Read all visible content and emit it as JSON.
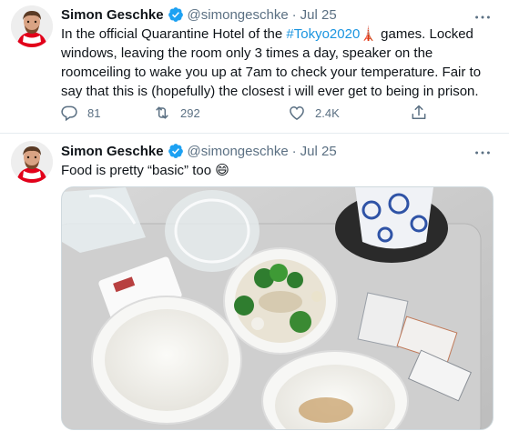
{
  "tweets": [
    {
      "author_name": "Simon Geschke",
      "handle": "@simongeschke",
      "separator": "·",
      "date": "Jul 25",
      "text_before": "In the official Quarantine Hotel of the ",
      "hashtag": "#Tokyo2020",
      "text_emoji": "🗼",
      "text_after": " games. Locked windows, leaving the room only 3 times a day, speaker on the roomceiling to wake you up at 7am to check your temperature. Fair to say that this is (hopefully) the closest i will ever get to being in prison.",
      "reply_count": "81",
      "retweet_count": "292",
      "like_count": "2.4K"
    },
    {
      "author_name": "Simon Geschke",
      "handle": "@simongeschke",
      "separator": "·",
      "date": "Jul 25",
      "text": "Food is pretty “basic” too 😄"
    }
  ],
  "icons": {
    "more": "more-icon",
    "verified": "verified-icon",
    "reply": "reply-icon",
    "retweet": "retweet-icon",
    "like": "heart-icon",
    "share": "share-icon"
  },
  "colors": {
    "accent": "#1b95e0",
    "verified": "#1da1f2",
    "secondary_text": "#5b7083"
  }
}
